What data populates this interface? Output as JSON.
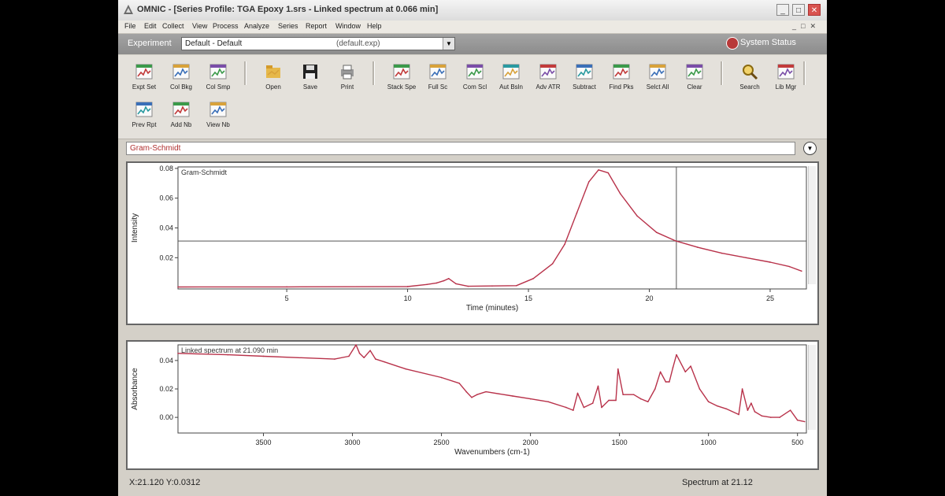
{
  "window": {
    "title": "OMNIC - [Series Profile: TGA Epoxy 1.srs - Linked spectrum at 0.066 min]",
    "buttons": {
      "minimize": "_",
      "maximize": "□",
      "close": "✕"
    }
  },
  "menubar": {
    "items": [
      "File",
      "Edit",
      "Collect",
      "View",
      "Process",
      "Analyze",
      "Series",
      "Report",
      "Window",
      "Help"
    ]
  },
  "experiment": {
    "label": "Experiment",
    "value": "Default - Default",
    "file": "(default.exp)",
    "system_status": "System Status"
  },
  "toolbar": {
    "buttons": [
      {
        "label": "Expt Set",
        "icon": "experiment-setup-icon"
      },
      {
        "label": "Col Bkg",
        "icon": "collect-background-icon"
      },
      {
        "label": "Col Smp",
        "icon": "collect-sample-icon"
      },
      {
        "label": "Open",
        "icon": "folder-open-icon"
      },
      {
        "label": "Save",
        "icon": "floppy-disk-icon"
      },
      {
        "label": "Print",
        "icon": "printer-icon"
      },
      {
        "label": "Stack Spe",
        "icon": "stack-spectra-icon"
      },
      {
        "label": "Full Sc",
        "icon": "full-scale-icon"
      },
      {
        "label": "Com Scl",
        "icon": "common-scale-icon"
      },
      {
        "label": "Aut Bsln",
        "icon": "auto-baseline-icon"
      },
      {
        "label": "Adv ATR",
        "icon": "advanced-atr-icon"
      },
      {
        "label": "Subtract",
        "icon": "subtract-icon"
      },
      {
        "label": "Find Pks",
        "icon": "find-peaks-icon"
      },
      {
        "label": "Selct All",
        "icon": "select-all-icon"
      },
      {
        "label": "Clear",
        "icon": "clear-icon"
      },
      {
        "label": "Search",
        "icon": "search-icon"
      },
      {
        "label": "Lib Mgr",
        "icon": "library-manager-icon"
      },
      {
        "label": "Prev Rpt",
        "icon": "preview-report-icon"
      },
      {
        "label": "Add Nb",
        "icon": "add-notebook-icon"
      },
      {
        "label": "View Nb",
        "icon": "view-notebook-icon"
      }
    ]
  },
  "profile_selector": {
    "value": "Gram-Schmidt"
  },
  "colors": {
    "trace": "#b8324a",
    "cursor": "#555555",
    "panel_border": "#666666"
  },
  "chart_data": [
    {
      "type": "line",
      "title": "Gram-Schmidt",
      "xlabel": "Time (minutes)",
      "ylabel": "Intensity",
      "xlim": [
        0.5,
        26.5
      ],
      "ylim": [
        -0.001,
        0.081
      ],
      "xticks": [
        5,
        10,
        15,
        20,
        25
      ],
      "yticks": [
        0.02,
        0.04,
        0.06,
        0.08
      ],
      "ytick_labels": [
        "0.02",
        "0.04",
        "0.06",
        "0.08"
      ],
      "cursor": {
        "x": 21.12,
        "y": 0.0312
      },
      "x": [
        0.5,
        5,
        10,
        10.8,
        11.2,
        11.5,
        11.7,
        12.0,
        12.5,
        13.5,
        14.5,
        15.2,
        16.0,
        16.5,
        17.0,
        17.5,
        17.9,
        18.3,
        18.8,
        19.5,
        20.3,
        21.1,
        22.0,
        23.0,
        24.0,
        25.0,
        25.8,
        26.3
      ],
      "y": [
        0.0003,
        0.0004,
        0.0006,
        0.002,
        0.003,
        0.0045,
        0.006,
        0.0025,
        0.0008,
        0.001,
        0.0012,
        0.006,
        0.016,
        0.029,
        0.05,
        0.071,
        0.079,
        0.077,
        0.063,
        0.048,
        0.037,
        0.0312,
        0.027,
        0.023,
        0.02,
        0.017,
        0.014,
        0.011
      ]
    },
    {
      "type": "line",
      "title": "Linked spectrum at 21.090 min",
      "xlabel": "Wavenumbers (cm-1)",
      "ylabel": "Absorbance",
      "xlim": [
        3980,
        450
      ],
      "ylim": [
        -0.011,
        0.051
      ],
      "xticks": [
        3500,
        3000,
        2500,
        2000,
        1500,
        1000,
        500
      ],
      "yticks": [
        0.0,
        0.02,
        0.04
      ],
      "ytick_labels": [
        "0.00",
        "0.02",
        "0.04"
      ],
      "x": [
        3980,
        3700,
        3500,
        3100,
        3020,
        2980,
        2960,
        2935,
        2900,
        2870,
        2820,
        2700,
        2500,
        2400,
        2360,
        2330,
        2300,
        2250,
        2100,
        2000,
        1900,
        1800,
        1760,
        1735,
        1700,
        1650,
        1620,
        1600,
        1560,
        1520,
        1508,
        1480,
        1420,
        1380,
        1340,
        1300,
        1270,
        1240,
        1220,
        1200,
        1180,
        1130,
        1100,
        1050,
        1000,
        950,
        900,
        830,
        810,
        780,
        760,
        740,
        700,
        650,
        600,
        540,
        500,
        460
      ],
      "y": [
        0.045,
        0.044,
        0.043,
        0.041,
        0.043,
        0.051,
        0.045,
        0.042,
        0.047,
        0.041,
        0.039,
        0.034,
        0.028,
        0.024,
        0.018,
        0.014,
        0.016,
        0.018,
        0.015,
        0.013,
        0.011,
        0.007,
        0.005,
        0.017,
        0.007,
        0.01,
        0.022,
        0.007,
        0.012,
        0.012,
        0.034,
        0.016,
        0.016,
        0.013,
        0.011,
        0.02,
        0.032,
        0.025,
        0.025,
        0.035,
        0.044,
        0.032,
        0.036,
        0.02,
        0.011,
        0.008,
        0.006,
        0.002,
        0.02,
        0.005,
        0.01,
        0.004,
        0.001,
        0.0,
        0.0,
        0.005,
        -0.002,
        -0.003
      ]
    }
  ],
  "status": {
    "coords": "X:21.120 Y:0.0312",
    "spectrum_at": "Spectrum at 21.12"
  }
}
